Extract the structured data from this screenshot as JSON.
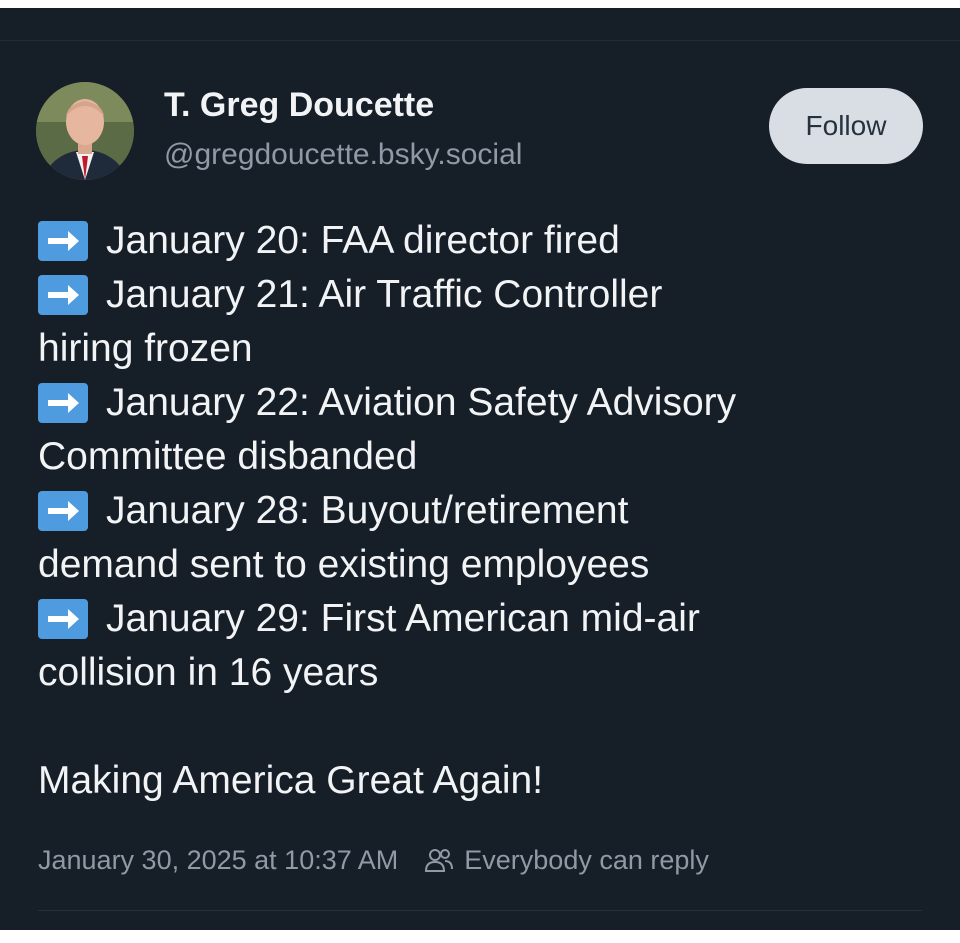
{
  "author": {
    "display_name": "T. Greg Doucette",
    "handle": "@gregdoucette.bsky.social",
    "avatar_icon": "person-avatar"
  },
  "actions": {
    "follow_label": "Follow"
  },
  "post": {
    "lines": [
      {
        "arrow": true,
        "text": "January 20: FAA director fired"
      },
      {
        "arrow": true,
        "text": "January 21: Air Traffic Controller"
      },
      {
        "arrow": false,
        "text": "hiring frozen"
      },
      {
        "arrow": true,
        "text": "January 22: Aviation Safety Advisory"
      },
      {
        "arrow": false,
        "text": "Committee disbanded"
      },
      {
        "arrow": true,
        "text": "January 28: Buyout/retirement"
      },
      {
        "arrow": false,
        "text": "demand sent to existing employees"
      },
      {
        "arrow": true,
        "text": "January 29: First American mid-air"
      },
      {
        "arrow": false,
        "text": "collision in 16 years"
      }
    ],
    "closing": "Making America Great Again!",
    "arrow_icon": "right-arrow-emoji"
  },
  "footer": {
    "timestamp": "January 30, 2025 at 10:37 AM",
    "reply_setting": "Everybody can reply",
    "reply_icon": "people-icon"
  },
  "colors": {
    "background": "#161e27",
    "text": "#f1f3f5",
    "muted": "#8f9aa6",
    "arrow_box": "#4f9be0",
    "follow_bg": "#d9dee4"
  }
}
